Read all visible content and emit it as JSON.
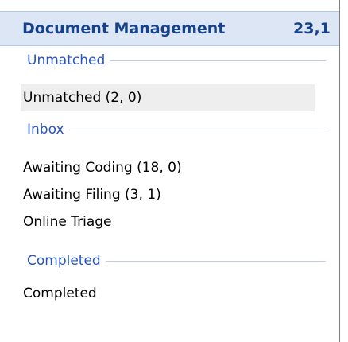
{
  "header": {
    "title": "Document Management",
    "count": "23,1"
  },
  "sections": [
    {
      "label": "Unmatched",
      "items": [
        {
          "label": "Unmatched (2, 0)",
          "selected": true
        }
      ]
    },
    {
      "label": "Inbox",
      "items": [
        {
          "label": "Awaiting Coding (18, 0)",
          "selected": false
        },
        {
          "label": "Awaiting Filing (3, 1)",
          "selected": false
        },
        {
          "label": "Online Triage",
          "selected": false
        }
      ]
    },
    {
      "label": "Completed",
      "items": [
        {
          "label": "Completed",
          "selected": false
        }
      ]
    }
  ],
  "colors": {
    "header_bg": "#dce6f4",
    "header_text": "#15428b",
    "section_text": "#2753c4",
    "selected_bg": "#eeeeee"
  }
}
